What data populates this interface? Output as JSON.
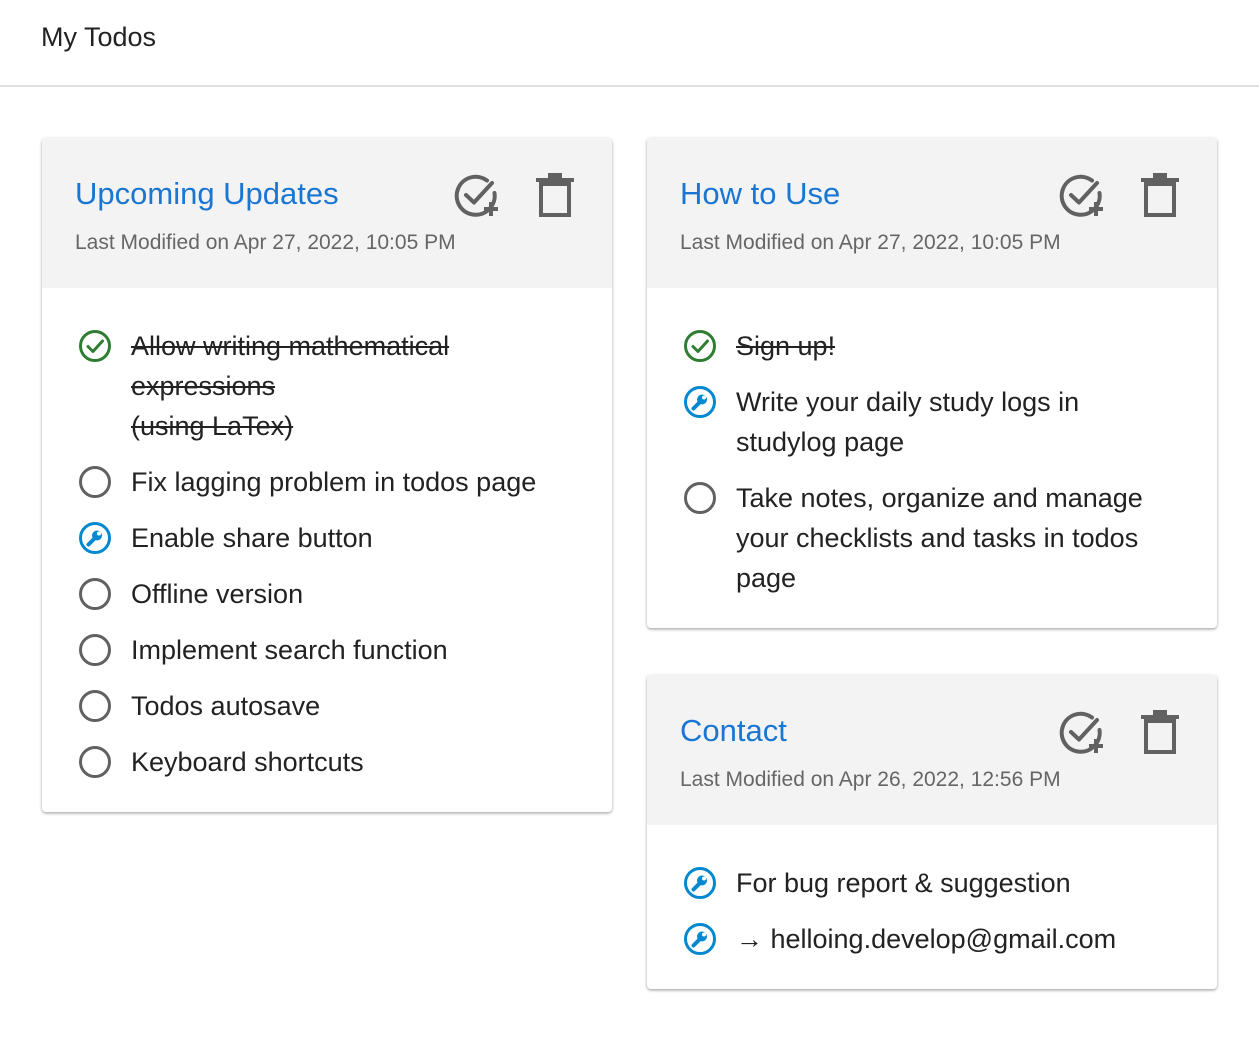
{
  "app": {
    "title": "My Todos"
  },
  "colors": {
    "title_blue": "#1976d2",
    "done_green": "#2e7d32",
    "progress_blue": "#0288d1",
    "icon_gray": "#616161"
  },
  "cards": [
    {
      "title": "Upcoming Updates",
      "modified": "Last Modified on Apr 27, 2022, 10:05 PM",
      "add_icon": "check-plus-icon",
      "delete_icon": "trash-icon",
      "items": [
        {
          "text": "Allow writing mathematical\nexpressions\n(using LaTex)",
          "status": "done",
          "icon": "check-circle-icon"
        },
        {
          "text": "Fix lagging problem in todos page",
          "status": "todo",
          "icon": "empty-circle-icon"
        },
        {
          "text": "Enable share button",
          "status": "in-progress",
          "icon": "wrench-circle-icon"
        },
        {
          "text": "Offline version",
          "status": "todo",
          "icon": "empty-circle-icon"
        },
        {
          "text": "Implement search function",
          "status": "todo",
          "icon": "empty-circle-icon"
        },
        {
          "text": "Todos autosave",
          "status": "todo",
          "icon": "empty-circle-icon"
        },
        {
          "text": "Keyboard shortcuts",
          "status": "todo",
          "icon": "empty-circle-icon"
        }
      ]
    },
    {
      "title": "How to Use",
      "modified": "Last Modified on Apr 27, 2022, 10:05 PM",
      "add_icon": "check-plus-icon",
      "delete_icon": "trash-icon",
      "items": [
        {
          "text": "Sign up!",
          "status": "done",
          "icon": "check-circle-icon"
        },
        {
          "text": "Write your daily study logs in\nstudylog page",
          "status": "in-progress",
          "icon": "wrench-circle-icon"
        },
        {
          "text": "Take notes, organize and manage\nyour checklists and tasks in todos\npage",
          "status": "todo",
          "icon": "empty-circle-icon"
        }
      ]
    },
    {
      "title": "Contact",
      "modified": "Last Modified on Apr 26, 2022, 12:56 PM",
      "add_icon": "check-plus-icon",
      "delete_icon": "trash-icon",
      "items": [
        {
          "text": "For bug report & suggestion",
          "status": "in-progress",
          "icon": "wrench-circle-icon"
        },
        {
          "text": "→ helloing.develop@gmail.com",
          "status": "in-progress",
          "icon": "wrench-circle-icon"
        }
      ]
    }
  ]
}
